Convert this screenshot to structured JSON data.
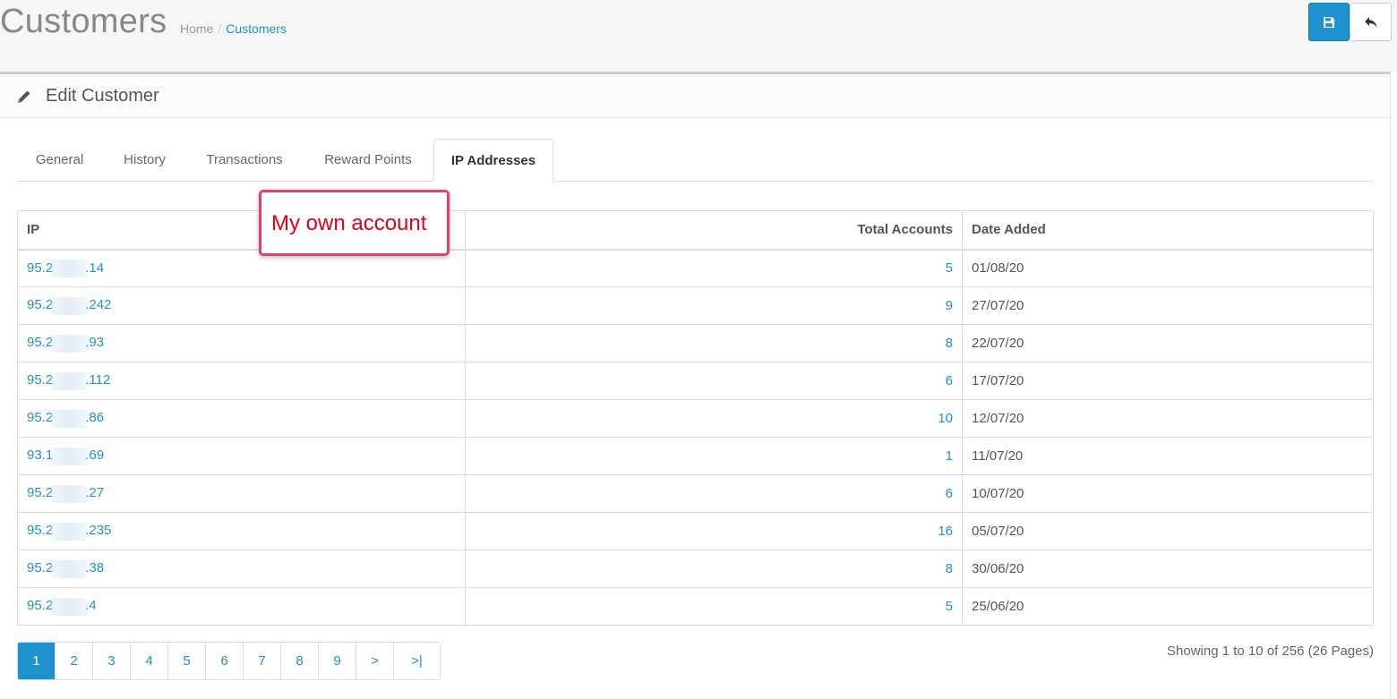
{
  "header": {
    "title": "Customers",
    "breadcrumb": [
      {
        "label": "Home"
      },
      {
        "label": "Customers"
      }
    ],
    "buttons": {
      "save_icon": "save-icon",
      "back_icon": "reply-icon"
    }
  },
  "panel": {
    "title": "Edit Customer",
    "icon": "pencil-icon"
  },
  "tabs": [
    {
      "label": "General"
    },
    {
      "label": "History"
    },
    {
      "label": "Transactions"
    },
    {
      "label": "Reward Points"
    },
    {
      "label": "IP Addresses",
      "active": true
    }
  ],
  "table": {
    "columns": [
      "IP",
      "Total Accounts",
      "Date Added"
    ],
    "rows": [
      {
        "ip_prefix": "95.2",
        "ip_suffix": ".14",
        "total": "5",
        "date": "01/08/20"
      },
      {
        "ip_prefix": "95.2",
        "ip_suffix": ".242",
        "total": "9",
        "date": "27/07/20"
      },
      {
        "ip_prefix": "95.2",
        "ip_suffix": ".93",
        "total": "8",
        "date": "22/07/20"
      },
      {
        "ip_prefix": "95.2",
        "ip_suffix": ".112",
        "total": "6",
        "date": "17/07/20"
      },
      {
        "ip_prefix": "95.2",
        "ip_suffix": ".86",
        "total": "10",
        "date": "12/07/20"
      },
      {
        "ip_prefix": "93.1",
        "ip_suffix": ".69",
        "total": "1",
        "date": "11/07/20"
      },
      {
        "ip_prefix": "95.2",
        "ip_suffix": ".27",
        "total": "6",
        "date": "10/07/20"
      },
      {
        "ip_prefix": "95.2",
        "ip_suffix": ".235",
        "total": "16",
        "date": "05/07/20"
      },
      {
        "ip_prefix": "95.2",
        "ip_suffix": ".38",
        "total": "8",
        "date": "30/06/20"
      },
      {
        "ip_prefix": "95.2",
        "ip_suffix": ".4",
        "total": "5",
        "date": "25/06/20"
      }
    ]
  },
  "annotation": {
    "text": "My own account",
    "color": "#e0001a"
  },
  "pagination": {
    "pages": [
      "1",
      "2",
      "3",
      "4",
      "5",
      "6",
      "7",
      "8",
      "9",
      ">",
      ">|"
    ],
    "active": "1",
    "summary": "Showing 1 to 10 of 256 (26 Pages)"
  },
  "colors": {
    "accent": "#1e91cf",
    "annotation_border": "#e83e6a"
  }
}
